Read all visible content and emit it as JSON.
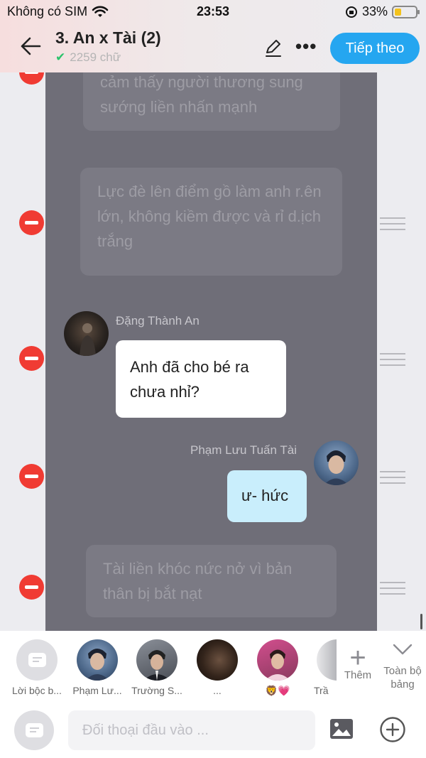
{
  "status": {
    "carrier": "Không có SIM",
    "time": "23:53",
    "battery": "33%",
    "battery_level": 0.33
  },
  "header": {
    "title": "3. An x Tài (2)",
    "word_count": "2259 chữ",
    "next_label": "Tiếp theo"
  },
  "chat": {
    "narration_1": "cảm thấy người thương sung sướng liền nhấn mạnh",
    "narration_2": "Lực đè lên điểm gồ làm anh r.ên lớn, không kiềm được và rỉ d.ịch trắng",
    "msg_an": {
      "name": "Đặng Thành An",
      "text": "Anh đã cho bé ra chưa nhỉ?"
    },
    "msg_tai": {
      "name": "Phạm Lưu Tuấn Tài",
      "text": "ư- hức"
    },
    "narration_3": "Tài liền khóc nức nở vì bản thân bị bắt nạt"
  },
  "characters": [
    {
      "label": "Lời bộc b..."
    },
    {
      "label": "Phạm Lư..."
    },
    {
      "label": "Trường S..."
    },
    {
      "label": "..."
    },
    {
      "label": "🦁💗"
    },
    {
      "label": "Trầ"
    }
  ],
  "actions": {
    "add_label": "Thêm",
    "all_board_label": "Toàn bộ bảng"
  },
  "input": {
    "placeholder": "Đối thoại đầu vào ..."
  },
  "colors": {
    "accent": "#25a6f0",
    "remove": "#f03b33",
    "chat_bg": "#6f6e78",
    "bubble_right": "#c9eefc"
  }
}
